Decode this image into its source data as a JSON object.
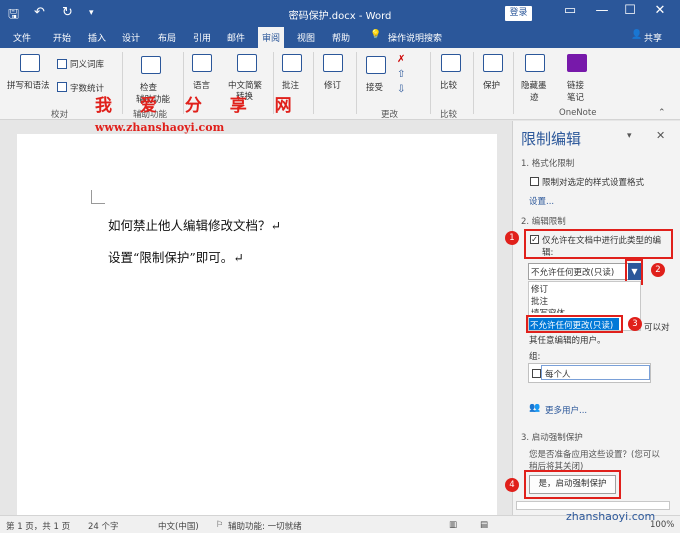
{
  "titlebar": {
    "doc_title": "密码保护.docx - Word",
    "login": "登录",
    "quick_access": [
      "save-icon",
      "undo-icon",
      "redo-icon",
      "customize-icon"
    ]
  },
  "tabs": [
    "文件",
    "开始",
    "插入",
    "设计",
    "布局",
    "引用",
    "邮件",
    "审阅",
    "视图",
    "帮助",
    "操作说明搜索",
    "共享"
  ],
  "ribbon": {
    "spell": "拼写和语法",
    "thesaurus": "同义词库",
    "wordcount": "字数统计",
    "proof_group": "校对",
    "check1": "检查",
    "check2": "辅助功能",
    "access_group": "辅助功能",
    "language": "语言",
    "chinese1": "中文简繁",
    "chinese2": "转换",
    "comments": "批注",
    "track": "修订",
    "accept": "接受",
    "changes_group": "更改",
    "compare": "比较",
    "compare_group": "比较",
    "protect": "保护",
    "hide1": "隐藏墨",
    "hide2": "迹",
    "link1": "链接",
    "link2": "笔记",
    "onenote_group": "OneNote"
  },
  "watermark": {
    "site": "我 爱 分 享 网",
    "url": "www.zhanshaoyi.com",
    "bottom": "zhanshaoyi.com"
  },
  "document": {
    "line1": "如何禁止他人编辑修改文档？↵",
    "line2": "设置“限制保护”即可。↵"
  },
  "pane": {
    "title": "限制编辑",
    "s1": "1. 格式化限制",
    "s1_check": "限制对选定的样式设置格式",
    "settings": "设置...",
    "s2": "2. 编辑限制",
    "s2_check_line1": "仅允许在文档中进行此类型的编",
    "s2_check_line2": "辑:",
    "dropdown_value": "不允许任何更改(只读)",
    "options": [
      "修订",
      "批注",
      "填写窗体",
      "不允许任何更改(只读)"
    ],
    "exceptions_tail": "可以对",
    "exceptions_line2": "其任意编辑的用户。",
    "groups": "组:",
    "everyone": "每个人",
    "more_users": "更多用户...",
    "s3": "3. 启动强制保护",
    "s3_desc1": "您是否准备应用这些设置？(您可以",
    "s3_desc2": "稍后将其关闭)",
    "start_btn": "是，启动强制保护",
    "badges": [
      "1",
      "2",
      "3",
      "4"
    ]
  },
  "status": {
    "page": "第 1 页，共 1 页",
    "words": "24 个字",
    "lang": "中文(中国)",
    "access": "辅助功能: 一切就绪",
    "zoom": "100%"
  },
  "colors": {
    "accent": "#2b579a",
    "annotation": "#e0201b",
    "selection": "#0078d7"
  }
}
